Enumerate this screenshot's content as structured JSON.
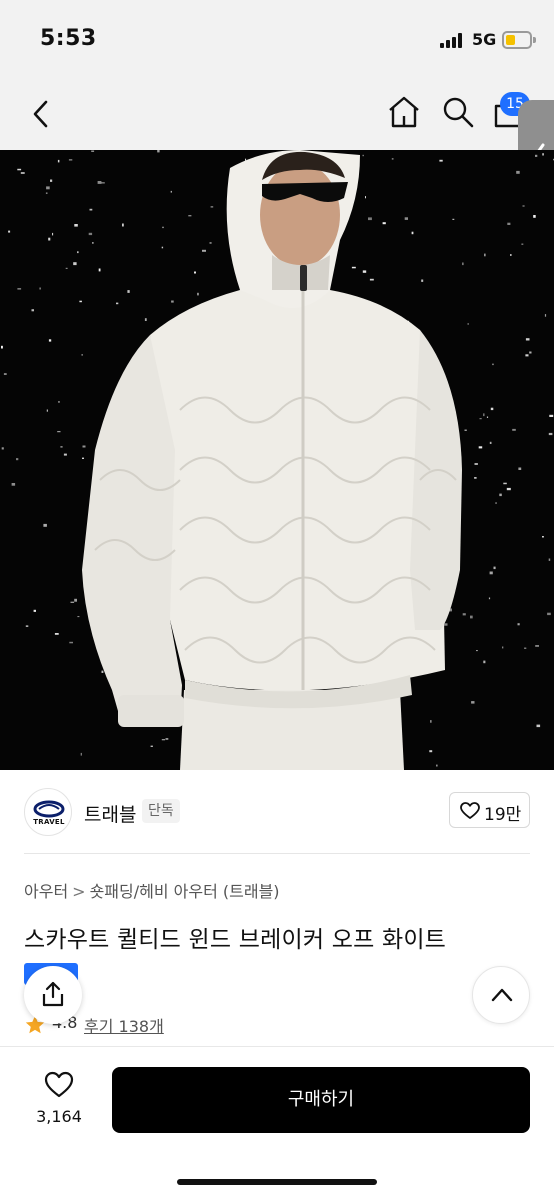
{
  "status_bar": {
    "time": "5:53",
    "network": "5G",
    "battery_color": "#f5c100"
  },
  "nav": {
    "back_icon": "chevron-left-icon",
    "home_icon": "home-icon",
    "search_icon": "search-icon",
    "cart_icon": "cart-icon",
    "cart_count": "15"
  },
  "hero": {
    "background_color": "#050505"
  },
  "brand": {
    "logo_text": "TRAVEL",
    "name": "트래블",
    "badge": "단독",
    "like_count": "19만"
  },
  "breadcrumb": [
    "아우터",
    "숏패딩/헤비 아우터 (트래블)"
  ],
  "product": {
    "title": "스카우트 퀼티드 윈드 브레이커 오프 화이트",
    "rating": "4.8",
    "reviews": "후기 138개"
  },
  "bottom_bar": {
    "wish_count": "3,164",
    "buy_label": "구매하기"
  },
  "colors": {
    "accent": "#1f6fff",
    "buy_button": "#000000",
    "star": "#f5a623"
  }
}
